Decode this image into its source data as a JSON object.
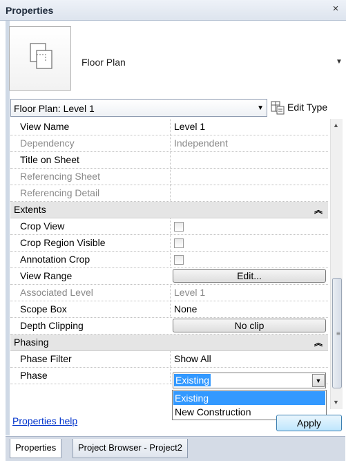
{
  "window": {
    "title": "Properties",
    "close_glyph": "×"
  },
  "type_selector": {
    "icon": "floor-plan-icon",
    "name": "Floor Plan"
  },
  "instance_selector": {
    "value": "Floor Plan: Level 1"
  },
  "edit_type": {
    "label": "Edit Type",
    "icon": "edit-type-icon"
  },
  "rows": [
    {
      "kind": "param",
      "name": "View Name",
      "value": "Level 1",
      "disabled": false
    },
    {
      "kind": "param",
      "name": "Dependency",
      "value": "Independent",
      "disabled": true
    },
    {
      "kind": "param",
      "name": "Title on Sheet",
      "value": "",
      "disabled": false
    },
    {
      "kind": "param",
      "name": "Referencing Sheet",
      "value": "",
      "disabled": true
    },
    {
      "kind": "param",
      "name": "Referencing Detail",
      "value": "",
      "disabled": true
    },
    {
      "kind": "group",
      "name": "Extents",
      "collapse_glyph": "≈"
    },
    {
      "kind": "checkbox",
      "name": "Crop View",
      "checked": false
    },
    {
      "kind": "checkbox",
      "name": "Crop Region Visible",
      "checked": false
    },
    {
      "kind": "checkbox",
      "name": "Annotation Crop",
      "checked": false
    },
    {
      "kind": "button",
      "name": "View Range",
      "button_label": "Edit..."
    },
    {
      "kind": "param",
      "name": "Associated Level",
      "value": "Level 1",
      "disabled": true
    },
    {
      "kind": "param",
      "name": "Scope Box",
      "value": "None",
      "disabled": false
    },
    {
      "kind": "button",
      "name": "Depth Clipping",
      "button_label": "No clip"
    },
    {
      "kind": "group",
      "name": "Phasing",
      "collapse_glyph": "≈"
    },
    {
      "kind": "param",
      "name": "Phase Filter",
      "value": "Show All",
      "disabled": false
    },
    {
      "kind": "param",
      "name": "Phase",
      "value": "",
      "disabled": false
    }
  ],
  "phase_dropdown": {
    "selected": "Existing",
    "options": [
      "Existing",
      "New Construction"
    ],
    "highlighted_index": 0
  },
  "footer": {
    "help_link": "Properties help",
    "apply_label": "Apply"
  },
  "tabs": [
    {
      "label": "Properties",
      "active": true
    },
    {
      "label": "Project Browser - Project2",
      "active": false
    }
  ],
  "colors": {
    "selection": "#3399ff",
    "link": "#0033cc",
    "group_bg": "#e5e5e5"
  }
}
